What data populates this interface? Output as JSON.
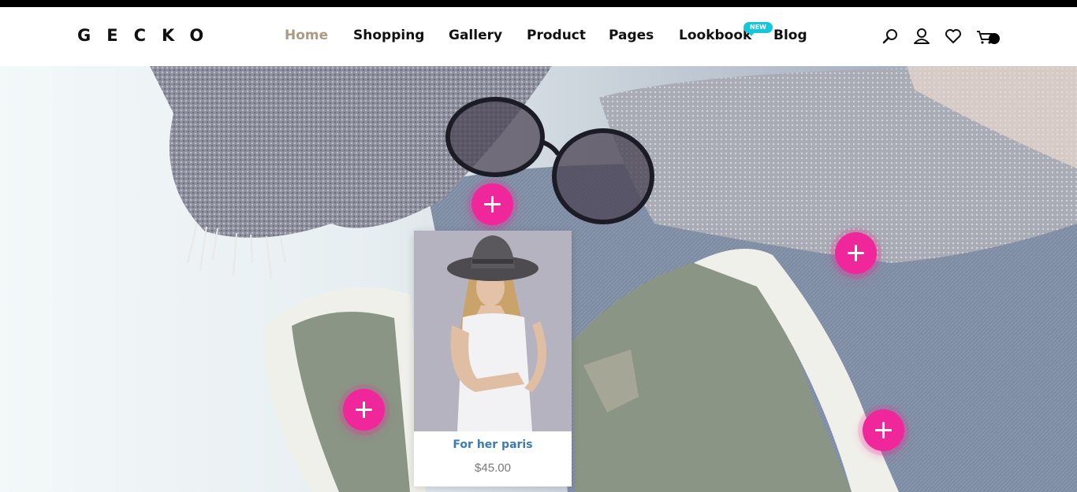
{
  "brand": {
    "logo": "GECKO"
  },
  "nav": {
    "items": [
      {
        "label": "Home",
        "active": true
      },
      {
        "label": "Shopping"
      },
      {
        "label": "Gallery"
      },
      {
        "label": "Product"
      },
      {
        "label": "Pages"
      },
      {
        "label": "Lookbook"
      },
      {
        "label": "Blog"
      }
    ],
    "lookbook_badge": "NEW"
  },
  "header_icons": [
    "search-icon",
    "user-icon",
    "heart-icon",
    "cart-icon"
  ],
  "lookbook": {
    "hotspot_count": 4,
    "product_card": {
      "name": "For her paris",
      "price": "$45.00"
    }
  },
  "colors": {
    "accent_pink": "#f0279a",
    "nav_active": "#ad9a84",
    "badge": "#12c8dc",
    "product_name": "#3a7bb5"
  }
}
